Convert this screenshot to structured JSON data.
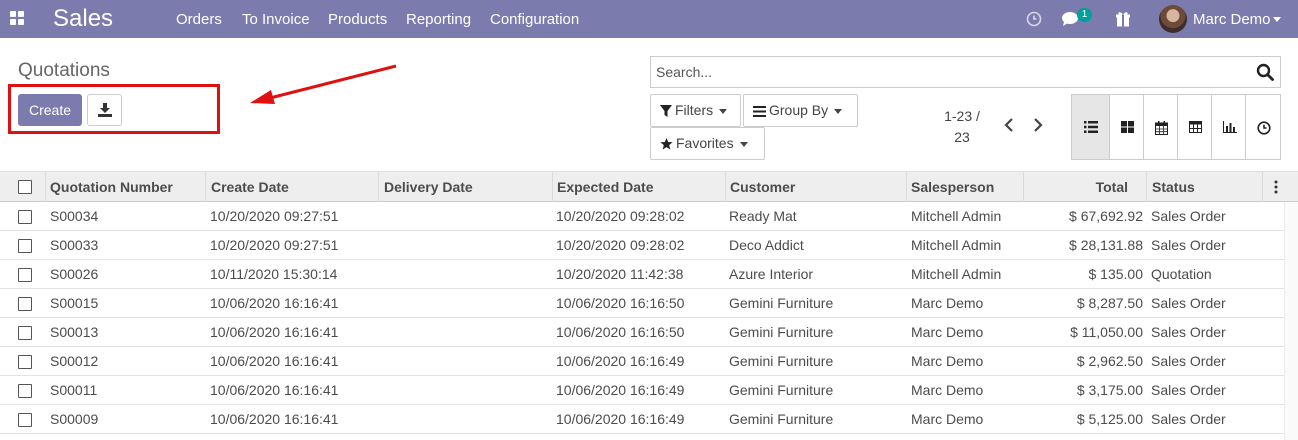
{
  "navbar": {
    "app_name": "Sales",
    "menu": [
      "Orders",
      "To Invoice",
      "Products",
      "Reporting",
      "Configuration"
    ],
    "messages_count": "1",
    "user_name": "Marc Demo",
    "color": "#7c7bad"
  },
  "control_panel": {
    "title": "Quotations",
    "create_label": "Create",
    "search_placeholder": "Search...",
    "filters_label": "Filters",
    "group_by_label": "Group By",
    "favorites_label": "Favorites",
    "pager_value": "1-23 /",
    "pager_total": "23",
    "views": [
      "list",
      "kanban",
      "calendar",
      "pivot",
      "graph",
      "activity"
    ],
    "active_view": "list"
  },
  "table": {
    "columns": [
      "Quotation Number",
      "Create Date",
      "Delivery Date",
      "Expected Date",
      "Customer",
      "Salesperson",
      "Total",
      "Status"
    ],
    "rows": [
      {
        "number": "S00034",
        "create_date": "10/20/2020 09:27:51",
        "delivery_date": "",
        "expected_date": "10/20/2020 09:28:02",
        "customer": "Ready Mat",
        "salesperson": "Mitchell Admin",
        "total": "$ 67,692.92",
        "status": "Sales Order"
      },
      {
        "number": "S00033",
        "create_date": "10/20/2020 09:27:51",
        "delivery_date": "",
        "expected_date": "10/20/2020 09:28:02",
        "customer": "Deco Addict",
        "salesperson": "Mitchell Admin",
        "total": "$ 28,131.88",
        "status": "Sales Order"
      },
      {
        "number": "S00026",
        "create_date": "10/11/2020 15:30:14",
        "delivery_date": "",
        "expected_date": "10/20/2020 11:42:38",
        "customer": "Azure Interior",
        "salesperson": "Mitchell Admin",
        "total": "$ 135.00",
        "status": "Quotation"
      },
      {
        "number": "S00015",
        "create_date": "10/06/2020 16:16:41",
        "delivery_date": "",
        "expected_date": "10/06/2020 16:16:50",
        "customer": "Gemini Furniture",
        "salesperson": "Marc Demo",
        "total": "$ 8,287.50",
        "status": "Sales Order"
      },
      {
        "number": "S00013",
        "create_date": "10/06/2020 16:16:41",
        "delivery_date": "",
        "expected_date": "10/06/2020 16:16:50",
        "customer": "Gemini Furniture",
        "salesperson": "Marc Demo",
        "total": "$ 11,050.00",
        "status": "Sales Order"
      },
      {
        "number": "S00012",
        "create_date": "10/06/2020 16:16:41",
        "delivery_date": "",
        "expected_date": "10/06/2020 16:16:49",
        "customer": "Gemini Furniture",
        "salesperson": "Marc Demo",
        "total": "$ 2,962.50",
        "status": "Sales Order"
      },
      {
        "number": "S00011",
        "create_date": "10/06/2020 16:16:41",
        "delivery_date": "",
        "expected_date": "10/06/2020 16:16:49",
        "customer": "Gemini Furniture",
        "salesperson": "Marc Demo",
        "total": "$ 3,175.00",
        "status": "Sales Order"
      },
      {
        "number": "S00009",
        "create_date": "10/06/2020 16:16:41",
        "delivery_date": "",
        "expected_date": "10/06/2020 16:16:49",
        "customer": "Gemini Furniture",
        "salesperson": "Marc Demo",
        "total": "$ 5,125.00",
        "status": "Sales Order"
      }
    ]
  },
  "annotation": {
    "highlight_color": "#e01010"
  }
}
